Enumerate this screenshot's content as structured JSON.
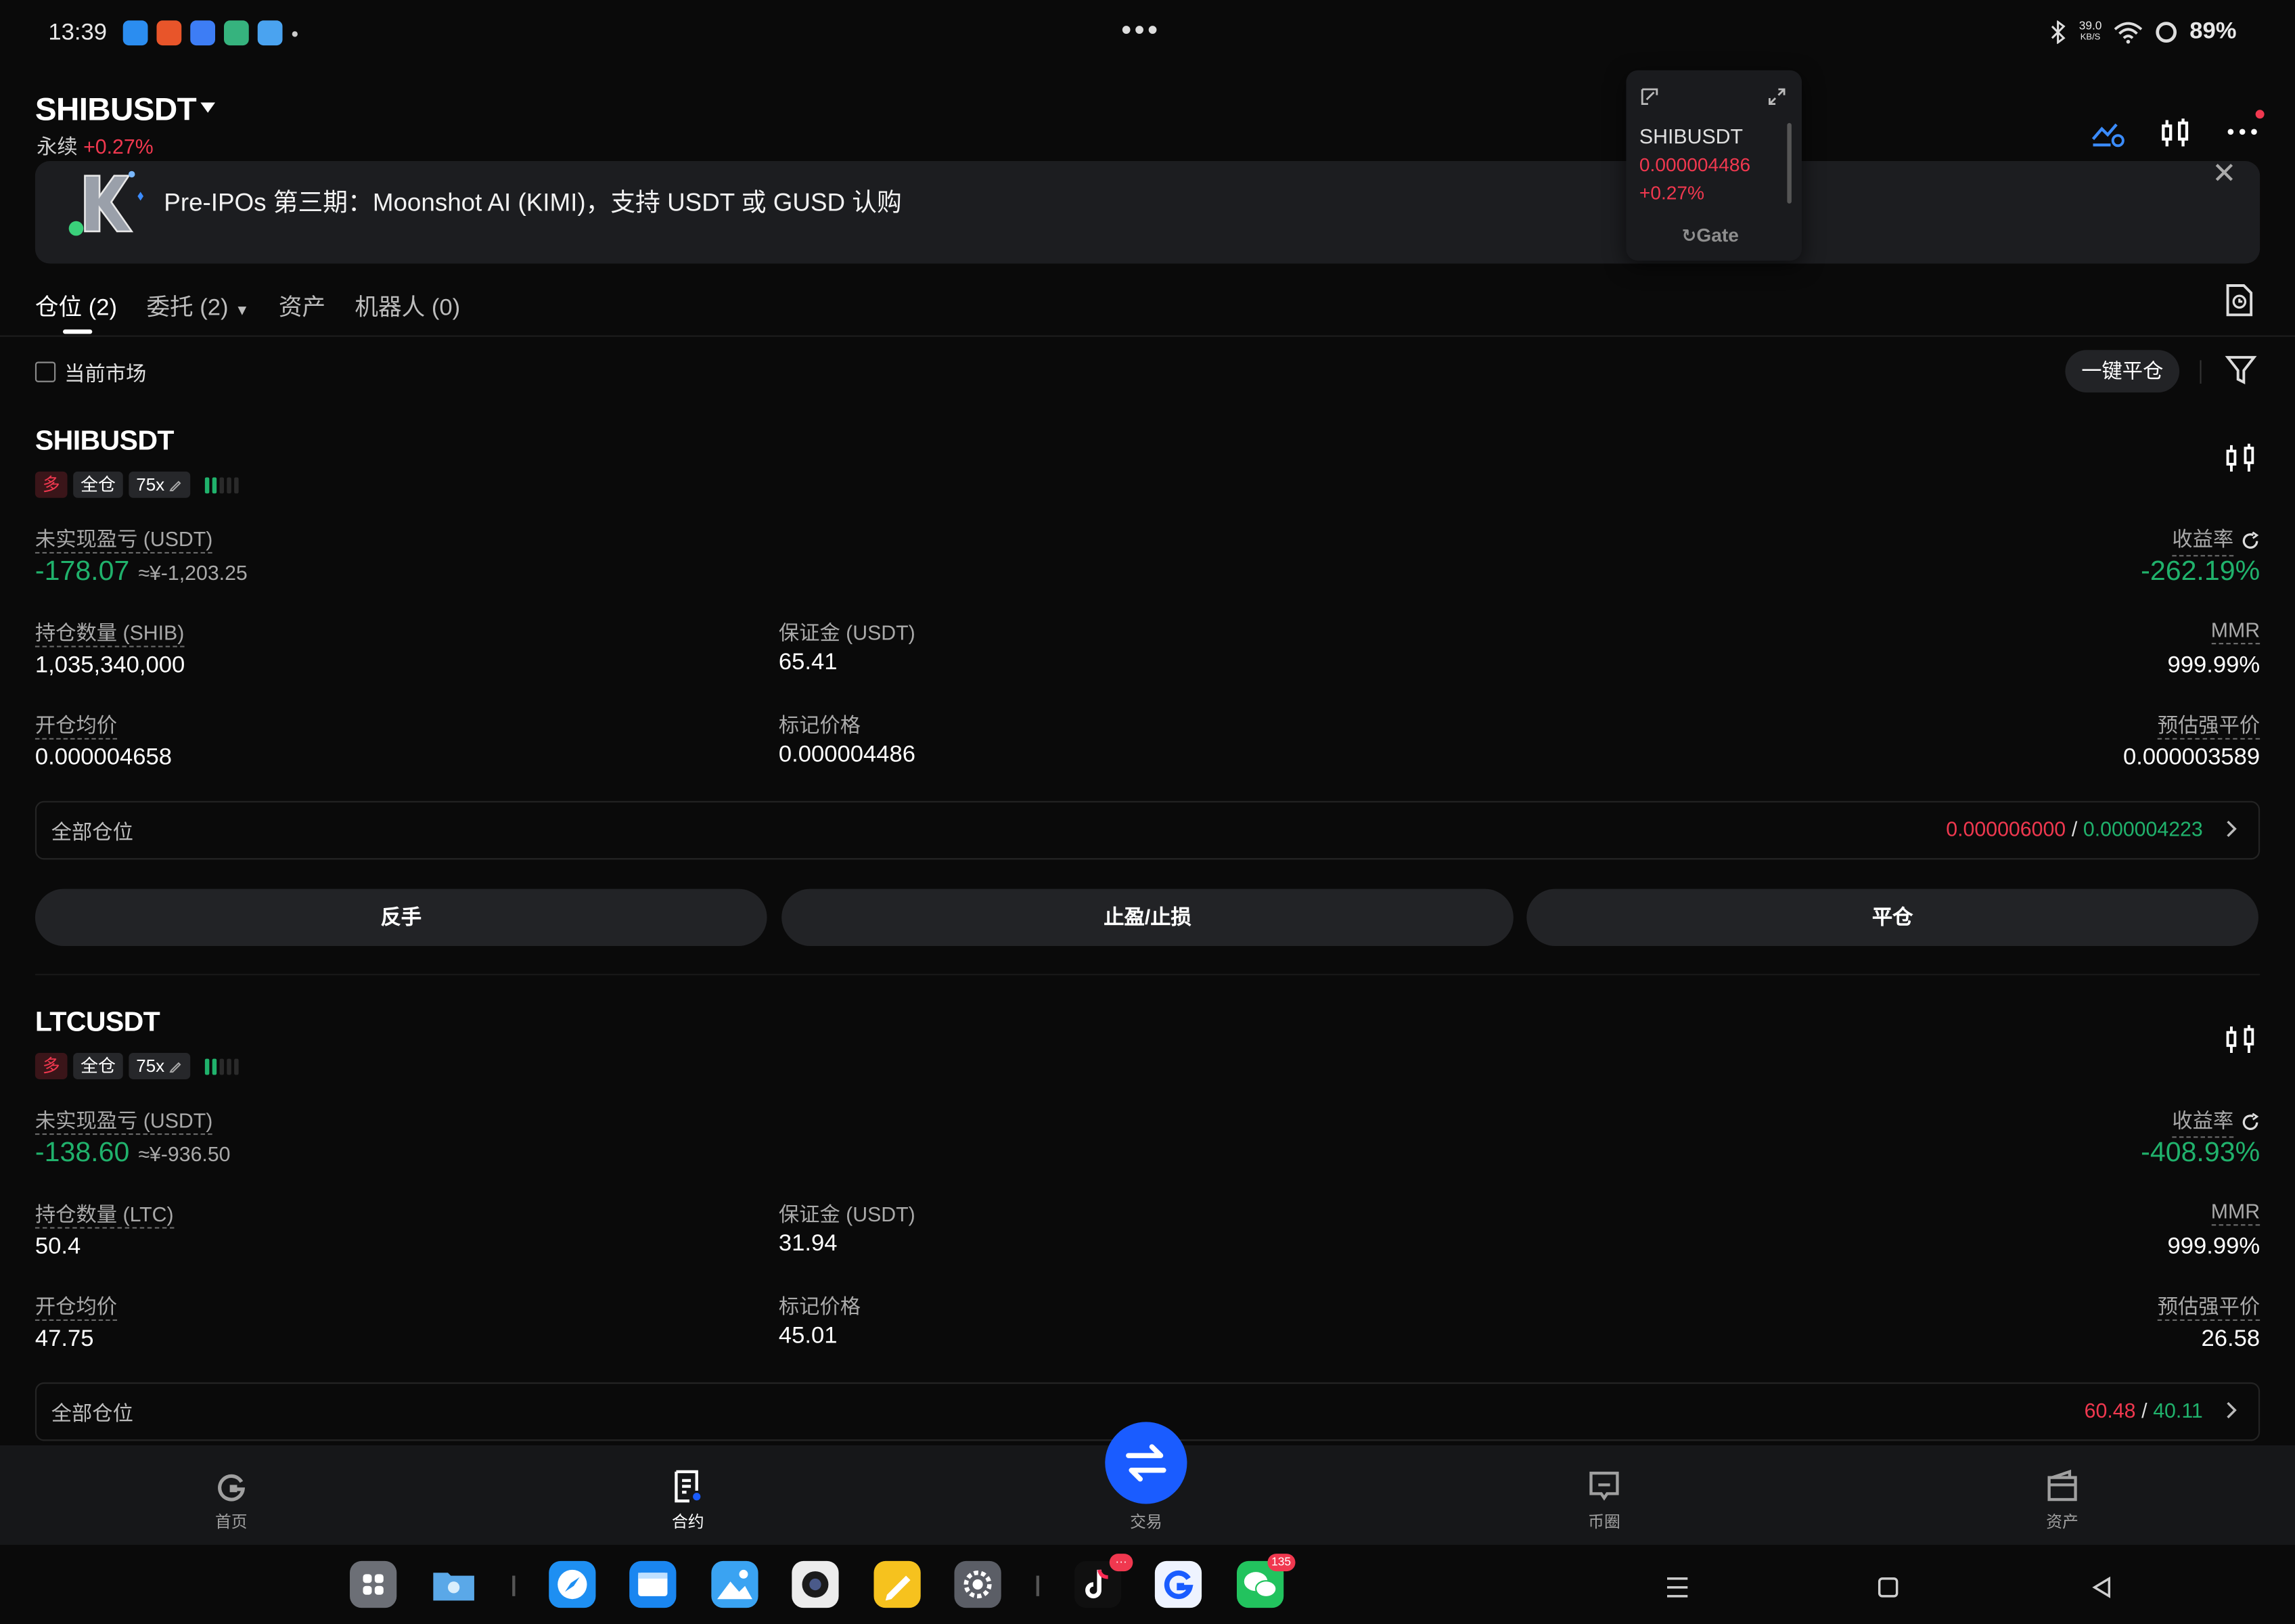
{
  "status_bar": {
    "time": "13:39",
    "dots": "•••",
    "net_speed": "39.0",
    "net_unit": "KB/S",
    "battery": "89%",
    "app_dot": "•"
  },
  "header": {
    "pair": "SHIBUSDT",
    "contract_type": "永续",
    "change": "+0.27%"
  },
  "banner": {
    "text": "Pre-IPOs 第三期：Moonshot AI (KIMI)，支持 USDT 或 GUSD 认购",
    "close": "✕"
  },
  "float_widget": {
    "pair": "SHIBUSDT",
    "price": "0.000004486",
    "change": "+0.27%",
    "brand": "Gate"
  },
  "tabs": [
    {
      "label": "仓位 (2)"
    },
    {
      "label": "委托 (2)"
    },
    {
      "label": "资产"
    },
    {
      "label": "机器人 (0)"
    }
  ],
  "filter": {
    "current_market": "当前市场",
    "close_all": "一键平仓"
  },
  "positions": [
    {
      "symbol": "SHIBUSDT",
      "side": "多",
      "margin_mode": "全仓",
      "leverage": "75x",
      "pnl_label": "未实现盈亏 (USDT)",
      "pnl_value": "-178.07",
      "pnl_cny": "≈¥-1,203.25",
      "roe_label": "收益率",
      "roe_value": "-262.19%",
      "size_label": "持仓数量 (SHIB)",
      "size_value": "1,035,340,000",
      "margin_label": "保证金 (USDT)",
      "margin_value": "65.41",
      "mmr_label": "MMR",
      "mmr_value": "999.99%",
      "entry_label": "开仓均价",
      "entry_value": "0.000004658",
      "mark_label": "标记价格",
      "mark_value": "0.000004486",
      "liq_label": "预估强平价",
      "liq_value": "0.000003589",
      "all_label": "全部仓位",
      "tp": "0.000006000",
      "slash": "/",
      "sl": "0.000004223",
      "btn_reverse": "反手",
      "btn_tpsl": "止盈/止损",
      "btn_close": "平仓"
    },
    {
      "symbol": "LTCUSDT",
      "side": "多",
      "margin_mode": "全仓",
      "leverage": "75x",
      "pnl_label": "未实现盈亏 (USDT)",
      "pnl_value": "-138.60",
      "pnl_cny": "≈¥-936.50",
      "roe_label": "收益率",
      "roe_value": "-408.93%",
      "size_label": "持仓数量 (LTC)",
      "size_value": "50.4",
      "margin_label": "保证金 (USDT)",
      "margin_value": "31.94",
      "mmr_label": "MMR",
      "mmr_value": "999.99%",
      "entry_label": "开仓均价",
      "entry_value": "47.75",
      "mark_label": "标记价格",
      "mark_value": "45.01",
      "liq_label": "预估强平价",
      "liq_value": "26.58",
      "all_label": "全部仓位",
      "tp": "60.48",
      "slash": "/",
      "sl": "40.11"
    }
  ],
  "bottom_nav": {
    "home": "首页",
    "futures": "合约",
    "trade": "交易",
    "community": "币圈",
    "assets": "资产"
  },
  "dock": {
    "tiktok_badge": "···",
    "wechat_badge": "135"
  },
  "colors": {
    "green": "#20b26c",
    "red": "#f0384f",
    "orange": "#f59a5c",
    "accent_blue": "#1a5cff"
  }
}
